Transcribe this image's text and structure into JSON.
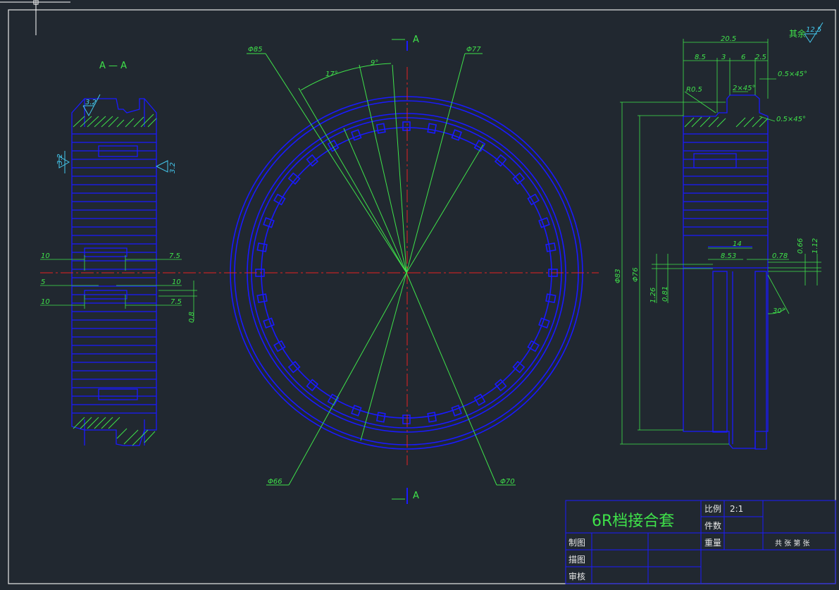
{
  "view_labels": {
    "section": "A — A",
    "arrow_top": "A",
    "arrow_bottom": "A"
  },
  "roughness": {
    "left_top": "3.2",
    "left_side_left": "3.2",
    "left_side_right": "3.2",
    "other": "其余",
    "other_value": "12.5"
  },
  "left_dims": {
    "d1": "10",
    "d2": "7.5",
    "d3": "5",
    "d4": "10",
    "d5": "10",
    "d6": "7.5",
    "d7": "0.8"
  },
  "front_dims": {
    "dia85": "Φ85",
    "dia77": "Φ77",
    "dia66": "Φ66",
    "dia70": "Φ70",
    "ang17": "17°",
    "ang9": "9°"
  },
  "right_dims": {
    "w": "20.5",
    "a": "8.5",
    "b": "3",
    "c": "6",
    "d": "2.5",
    "ch1": "0.5×45°",
    "ch2": "2×45°",
    "ch3": "0.5×45°",
    "r": "R0.5",
    "dia83": "Φ83",
    "dia76": "Φ76",
    "e": "14",
    "f": "8.53",
    "g": "0.78",
    "h": "0.66",
    "i": "1.12",
    "j": "1.26",
    "k": "0.81",
    "ang30": "30°"
  },
  "title_block": {
    "part_name": "6R档接合套",
    "scale_label": "比例",
    "scale_value": "2:1",
    "qty_label": "件数",
    "weight_label": "重量",
    "sheet_info": "共  张  第  张",
    "drawn": "制图",
    "traced": "描图",
    "checked": "审核"
  },
  "colors": {
    "background": "#212830",
    "outline": "#1a1aff",
    "dimension": "#3fe24a",
    "roughness": "#44c8ee",
    "centerline": "#e52222",
    "frame": "#e8e8e8"
  }
}
